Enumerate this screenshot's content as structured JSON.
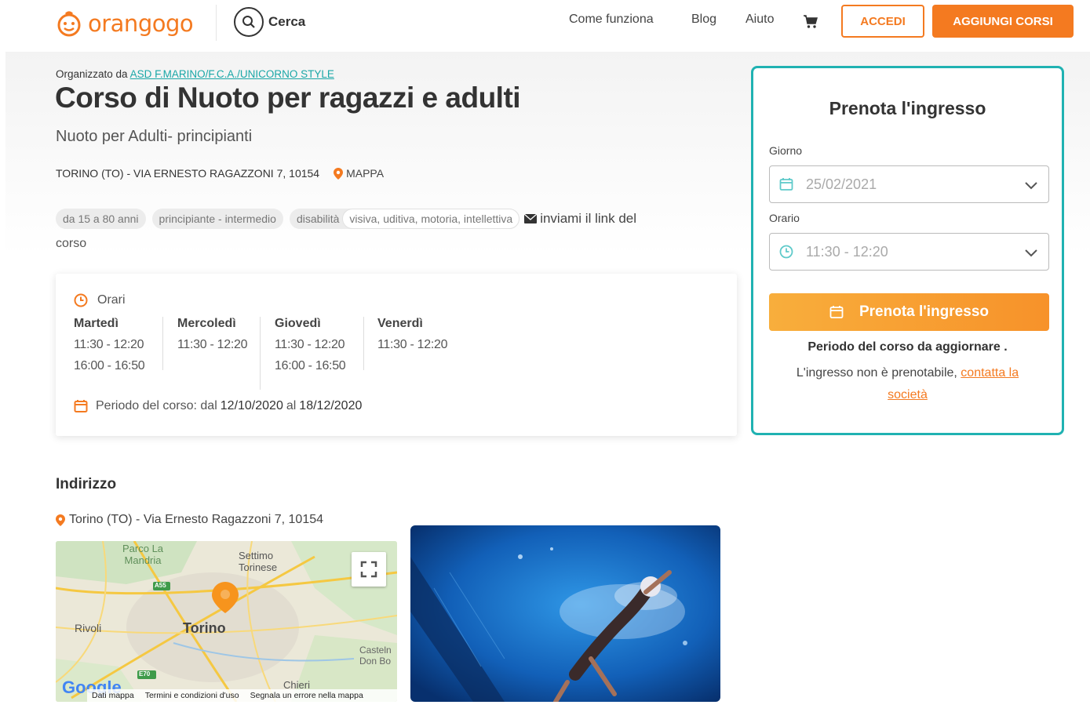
{
  "header": {
    "logo_text": "orangogo",
    "search_label": "Cerca",
    "nav": [
      "Come funziona",
      "Blog",
      "Aiuto"
    ],
    "login_label": "ACCEDI",
    "add_courses_label": "AGGIUNGI CORSI"
  },
  "course": {
    "organized_by_label": "Organizzato da",
    "organizer": "ASD F.MARINO/F.C.A./UNICORNO STYLE",
    "title": "Corso di Nuoto per ragazzi e adulti",
    "subtitle": "Nuoto per Adulti- principianti",
    "address_upper": "TORINO (TO) - VIA ERNESTO RAGAZZONI 7, 10154",
    "map_link": "MAPPA",
    "tags": {
      "age": "da 15 a 80 anni",
      "level": "principiante - intermedio",
      "disability_label": "disabilità",
      "disability_types": "visiva, uditiva, motoria, intellettiva"
    },
    "send_link_label": "inviami il link del",
    "send_link_cont": "corso"
  },
  "schedule": {
    "heading": "Orari",
    "days": [
      {
        "name": "Martedì",
        "slots": [
          "11:30 - 12:20",
          "16:00 - 16:50"
        ]
      },
      {
        "name": "Mercoledì",
        "slots": [
          "11:30 - 12:20"
        ]
      },
      {
        "name": "Giovedì",
        "slots": [
          "11:30 - 12:20",
          "16:00 - 16:50"
        ]
      },
      {
        "name": "Venerdì",
        "slots": [
          "11:30 - 12:20"
        ]
      }
    ],
    "period_prefix": "Periodo del corso: dal",
    "period_from": "12/10/2020",
    "period_mid": "al",
    "period_to": "18/12/2020"
  },
  "address_section": {
    "heading": "Indirizzo",
    "address": "Torino (TO) - Via Ernesto Ragazzoni 7, 10154",
    "map_labels": {
      "parco": "Parco La\nMandria",
      "settimo": "Settimo\nTorinese",
      "rivoli": "Rivoli",
      "torino": "Torino",
      "castel": "Casteln\nDon Bo",
      "chieri": "Chieri",
      "a55": "A55",
      "e70": "E70",
      "google": "Google",
      "footer": [
        "Dati mappa",
        "Termini e condizioni d'uso",
        "Segnala un errore nella mappa"
      ]
    }
  },
  "booking": {
    "title": "Prenota l'ingresso",
    "day_label": "Giorno",
    "day_value": "25/02/2021",
    "time_label": "Orario",
    "time_value": "11:30 - 12:20",
    "button_label": "Prenota l'ingresso",
    "note": "Periodo del corso da aggiornare .",
    "msg_prefix": "L'ingresso non è prenotabile,",
    "msg_link": "contatta la società"
  },
  "colors": {
    "brand_orange": "#f47a20",
    "teal": "#20b2b2"
  }
}
